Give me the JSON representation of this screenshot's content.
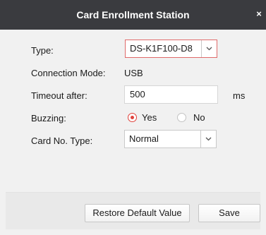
{
  "window": {
    "title": "Card Enrollment Station",
    "close_glyph": "×"
  },
  "form": {
    "type": {
      "label": "Type:",
      "value": "DS-K1F100-D8"
    },
    "connection_mode": {
      "label": "Connection Mode:",
      "value": "USB"
    },
    "timeout": {
      "label": "Timeout after:",
      "value": "500",
      "unit": "ms"
    },
    "buzzing": {
      "label": "Buzzing:",
      "options": [
        {
          "label": "Yes",
          "selected": true
        },
        {
          "label": "No",
          "selected": false
        }
      ]
    },
    "card_no_type": {
      "label": "Card No. Type:",
      "value": "Normal"
    }
  },
  "footer": {
    "restore_label": "Restore Default Value",
    "save_label": "Save"
  },
  "colors": {
    "titlebar": "#3a3b3f",
    "accent_red": "#e0423c"
  }
}
